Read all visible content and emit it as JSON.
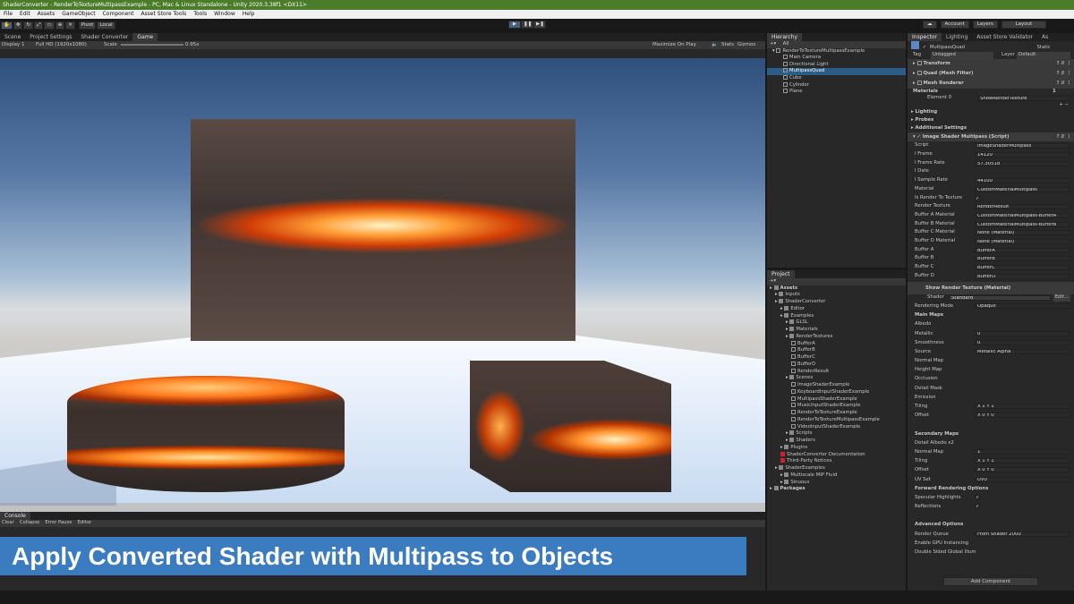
{
  "titlebar": "ShaderConverter - RenderToTextureMultipassExample - PC, Mac & Linux Standalone - Unity 2020.3.38f1 <DX11>",
  "menu": [
    "File",
    "Edit",
    "Assets",
    "GameObject",
    "Component",
    "Asset Store Tools",
    "Tools",
    "Window",
    "Help"
  ],
  "toolbar": {
    "pivot": "Pivot",
    "local": "Local",
    "play": "▶",
    "pause": "❚❚",
    "step": "▶❚",
    "account": "Account",
    "layers": "Layers",
    "layout": "Layout"
  },
  "game": {
    "tabs": [
      "Scene",
      "Project Settings",
      "Shader Converter",
      "Game"
    ],
    "display": "Display 1",
    "resolution": "Full HD (1920x1080)",
    "scale_label": "Scale",
    "scale_value": "0.95x",
    "maximize": "Maximize On Play",
    "stats": "Stats",
    "gizmos": "Gizmos"
  },
  "hierarchy": {
    "tab": "Hierarchy",
    "search": "All",
    "scene": "RenderToTextureMultipassExample",
    "items": [
      "Main Camera",
      "Directional Light",
      "MultipassQuad",
      "Cube",
      "Cylinder",
      "Plane"
    ],
    "selected": 2
  },
  "project": {
    "tab": "Project",
    "items": [
      [
        "Assets",
        0,
        "f"
      ],
      [
        "Inputs",
        1,
        "f"
      ],
      [
        "ShaderConverter",
        1,
        "f"
      ],
      [
        "Editor",
        2,
        "f"
      ],
      [
        "Examples",
        2,
        "f"
      ],
      [
        "GLSL",
        3,
        "f"
      ],
      [
        "Materials",
        3,
        "f"
      ],
      [
        "RenderTextures",
        3,
        "f"
      ],
      [
        "BufferA",
        4,
        "a"
      ],
      [
        "BufferB",
        4,
        "a"
      ],
      [
        "BufferC",
        4,
        "a"
      ],
      [
        "BufferD",
        4,
        "a"
      ],
      [
        "RenderResult",
        4,
        "a"
      ],
      [
        "Scenes",
        3,
        "f"
      ],
      [
        "ImageShaderExample",
        4,
        "s"
      ],
      [
        "KeyboardInputShaderExample",
        4,
        "s"
      ],
      [
        "MultipassShaderExample",
        4,
        "s"
      ],
      [
        "MusicInputShaderExample",
        4,
        "s"
      ],
      [
        "RenderToTextureExample",
        4,
        "s"
      ],
      [
        "RenderToTextureMultipassExample",
        4,
        "s"
      ],
      [
        "VideoInputShaderExample",
        4,
        "s"
      ],
      [
        "Scripts",
        3,
        "f"
      ],
      [
        "Shaders",
        3,
        "f"
      ],
      [
        "Plugins",
        2,
        "f"
      ],
      [
        "ShaderConverter Documentation",
        2,
        "d"
      ],
      [
        "Third-Party Notices",
        2,
        "d"
      ],
      [
        "ShaderExamples",
        1,
        "f"
      ],
      [
        "Multiscale MIP Fluid",
        2,
        "f"
      ],
      [
        "Sinuous",
        2,
        "f"
      ],
      [
        "Packages",
        0,
        "f"
      ]
    ]
  },
  "inspector": {
    "tabs": [
      "Inspector",
      "Lighting",
      "Asset Store Validator",
      "As"
    ],
    "object": "MultipassQuad",
    "static": "Static",
    "tag_label": "Tag",
    "tag": "Untagged",
    "layer_label": "Layer",
    "layer": "Default",
    "components": [
      "Transform",
      "Quad (Mesh Filter)",
      "Mesh Renderer"
    ],
    "materials_label": "Materials",
    "materials_count": "1",
    "element0": "Element 0",
    "element0_value": "ShowRenderTexture",
    "sections": [
      "Lighting",
      "Probes",
      "Additional Settings"
    ],
    "script_header": "Image Shader Multipass (Script)",
    "fields": [
      [
        "Script",
        "ImageShaderMultipass"
      ],
      [
        "I Frame",
        "14120"
      ],
      [
        "I Frame Rate",
        "57.30518"
      ],
      [
        "I Date",
        ""
      ],
      [
        "I Sample Rate",
        "44100"
      ],
      [
        "Material",
        "CustomMaterialMultipass"
      ],
      [
        "Is Render To Texture",
        "✓"
      ],
      [
        "Render Texture",
        "RenderResult"
      ],
      [
        "Buffer A Material",
        "CustomMaterialMultipass-BufferA"
      ],
      [
        "Buffer B Material",
        "CustomMaterialMultipass-BufferB"
      ],
      [
        "Buffer C Material",
        "None (Material)"
      ],
      [
        "Buffer D Material",
        "None (Material)"
      ],
      [
        "Buffer A",
        "BufferA"
      ],
      [
        "Buffer B",
        "BufferB"
      ],
      [
        "Buffer C",
        "BufferC"
      ],
      [
        "Buffer D",
        "BufferD"
      ]
    ],
    "material_header": "Show Render Texture (Material)",
    "shader_label": "Shader",
    "shader": "Standard",
    "edit": "Edit...",
    "mat_fields": [
      [
        "Rendering Mode",
        "Opaque"
      ],
      [
        "Main Maps",
        ""
      ],
      [
        "Albedo",
        ""
      ],
      [
        "Metallic",
        "0"
      ],
      [
        "Smoothness",
        "0"
      ],
      [
        "Source",
        "Metallic Alpha"
      ],
      [
        "Normal Map",
        ""
      ],
      [
        "Height Map",
        ""
      ],
      [
        "Occlusion",
        ""
      ],
      [
        "Detail Mask",
        ""
      ],
      [
        "Emission",
        ""
      ],
      [
        "Tiling",
        "X 1     Y 1"
      ],
      [
        "Offset",
        "X 0     Y 0"
      ],
      [
        "",
        ""
      ],
      [
        "Secondary Maps",
        ""
      ],
      [
        "Detail Albedo x2",
        ""
      ],
      [
        "Normal Map",
        "1"
      ],
      [
        "Tiling",
        "X 1     Y 1"
      ],
      [
        "Offset",
        "X 0     Y 0"
      ],
      [
        "UV Set",
        "UV0"
      ],
      [
        "Forward Rendering Options",
        ""
      ],
      [
        "Specular Highlights",
        "✓"
      ],
      [
        "Reflections",
        "✓"
      ],
      [
        "",
        ""
      ],
      [
        "Advanced Options",
        ""
      ],
      [
        "Render Queue",
        "From Shader   2000"
      ],
      [
        "Enable GPU Instancing",
        ""
      ],
      [
        "Double Sided Global Illum",
        ""
      ]
    ],
    "add_component": "Add Component"
  },
  "console": {
    "tab": "Console",
    "buttons": [
      "Clear",
      "Collapse",
      "Error Pause",
      "Editor"
    ]
  },
  "banner": "Apply Converted Shader with Multipass to Objects"
}
